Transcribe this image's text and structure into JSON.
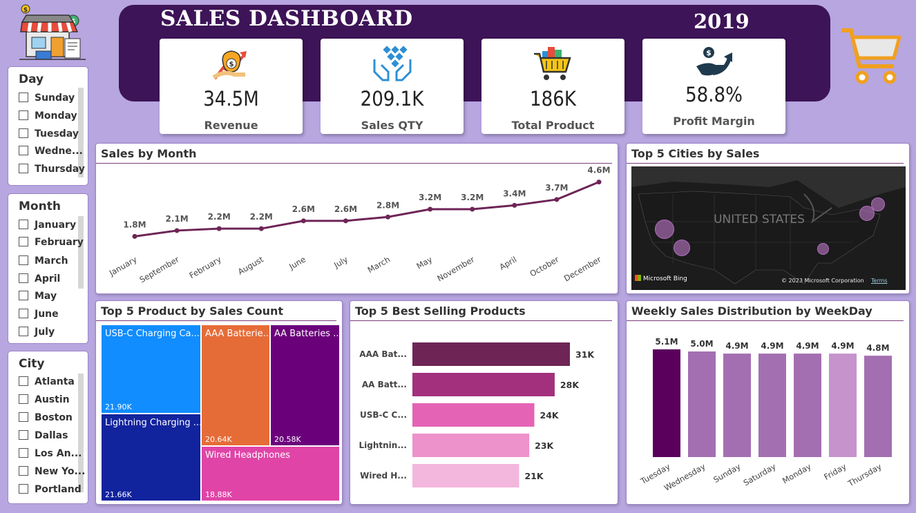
{
  "header": {
    "title": "SALES DASHBOARD",
    "year": "2019"
  },
  "kpis": [
    {
      "value": "34.5M",
      "label": "Revenue",
      "icon": "revenue-money-bag-icon"
    },
    {
      "value": "209.1K",
      "label": "Sales QTY",
      "icon": "hands-boxes-icon"
    },
    {
      "value": "186K",
      "label": "Total Product",
      "icon": "shopping-basket-icon"
    },
    {
      "value": "58.8%",
      "label": "Profit Margin",
      "icon": "hand-dollar-arrow-icon"
    }
  ],
  "slicers": {
    "day": {
      "title": "Day",
      "items": [
        "Sunday",
        "Monday",
        "Tuesday",
        "Wedne...",
        "Thursday"
      ]
    },
    "month": {
      "title": "Month",
      "items": [
        "January",
        "February",
        "March",
        "April",
        "May",
        "June",
        "July"
      ]
    },
    "city": {
      "title": "City",
      "items": [
        "Atlanta",
        "Austin",
        "Boston",
        "Dallas",
        "Los An...",
        "New Yo...",
        "Portland"
      ]
    }
  },
  "sales_by_month": {
    "title": "Sales by Month",
    "chart_data": {
      "type": "line",
      "categories": [
        "January",
        "September",
        "February",
        "August",
        "June",
        "July",
        "March",
        "May",
        "November",
        "April",
        "October",
        "December"
      ],
      "values": [
        1.8,
        2.1,
        2.2,
        2.2,
        2.6,
        2.6,
        2.8,
        3.2,
        3.2,
        3.4,
        3.7,
        4.6
      ],
      "labels": [
        "1.8M",
        "2.1M",
        "2.2M",
        "2.2M",
        "2.6M",
        "2.6M",
        "2.8M",
        "3.2M",
        "3.2M",
        "3.4M",
        "3.7M",
        "4.6M"
      ],
      "color": "#6e2556"
    }
  },
  "map": {
    "title": "Top 5 Cities by Sales",
    "country_label": "UNITED STATES",
    "attribution_left": "Microsoft Bing",
    "attribution_right": "© 2023 Microsoft Corporation",
    "terms": "Terms"
  },
  "treemap": {
    "title": "Top 5 Product by Sales Count",
    "chart_data": {
      "type": "treemap",
      "items": [
        {
          "name": "USB-C Charging Ca...",
          "value": "21.90K",
          "color": "#118dff"
        },
        {
          "name": "Lightning Charging ...",
          "value": "21.66K",
          "color": "#12239e"
        },
        {
          "name": "AAA Batterie...",
          "value": "20.64K",
          "color": "#e66c37"
        },
        {
          "name": "AA Batteries ...",
          "value": "20.58K",
          "color": "#6b007b"
        },
        {
          "name": "Wired Headphones",
          "value": "18.88K",
          "color": "#e044a7"
        }
      ]
    }
  },
  "best_selling": {
    "title": "Top 5 Best Selling Products",
    "chart_data": {
      "type": "bar",
      "categories": [
        "AAA Bat...",
        "AA Batt...",
        "USB-C C...",
        "Lightnin...",
        "Wired H..."
      ],
      "values": [
        31,
        28,
        24,
        23,
        21
      ],
      "labels": [
        "31K",
        "28K",
        "24K",
        "23K",
        "21K"
      ],
      "colors": [
        "#6e2556",
        "#a2307c",
        "#e563b5",
        "#ee92cc",
        "#f3b6dd"
      ]
    }
  },
  "weekday": {
    "title": "Weekly Sales Distribution by WeekDay",
    "chart_data": {
      "type": "bar",
      "categories": [
        "Tuesday",
        "Wednesday",
        "Sunday",
        "Saturday",
        "Monday",
        "Friday",
        "Thursday"
      ],
      "values": [
        5.1,
        5.0,
        4.9,
        4.9,
        4.9,
        4.9,
        4.8
      ],
      "labels": [
        "5.1M",
        "5.0M",
        "4.9M",
        "4.9M",
        "4.9M",
        "4.9M",
        "4.8M"
      ],
      "colors": [
        "#5a005c",
        "#a46fb1",
        "#a46fb1",
        "#a46fb1",
        "#a46fb1",
        "#c693cc",
        "#a46fb1"
      ]
    }
  }
}
